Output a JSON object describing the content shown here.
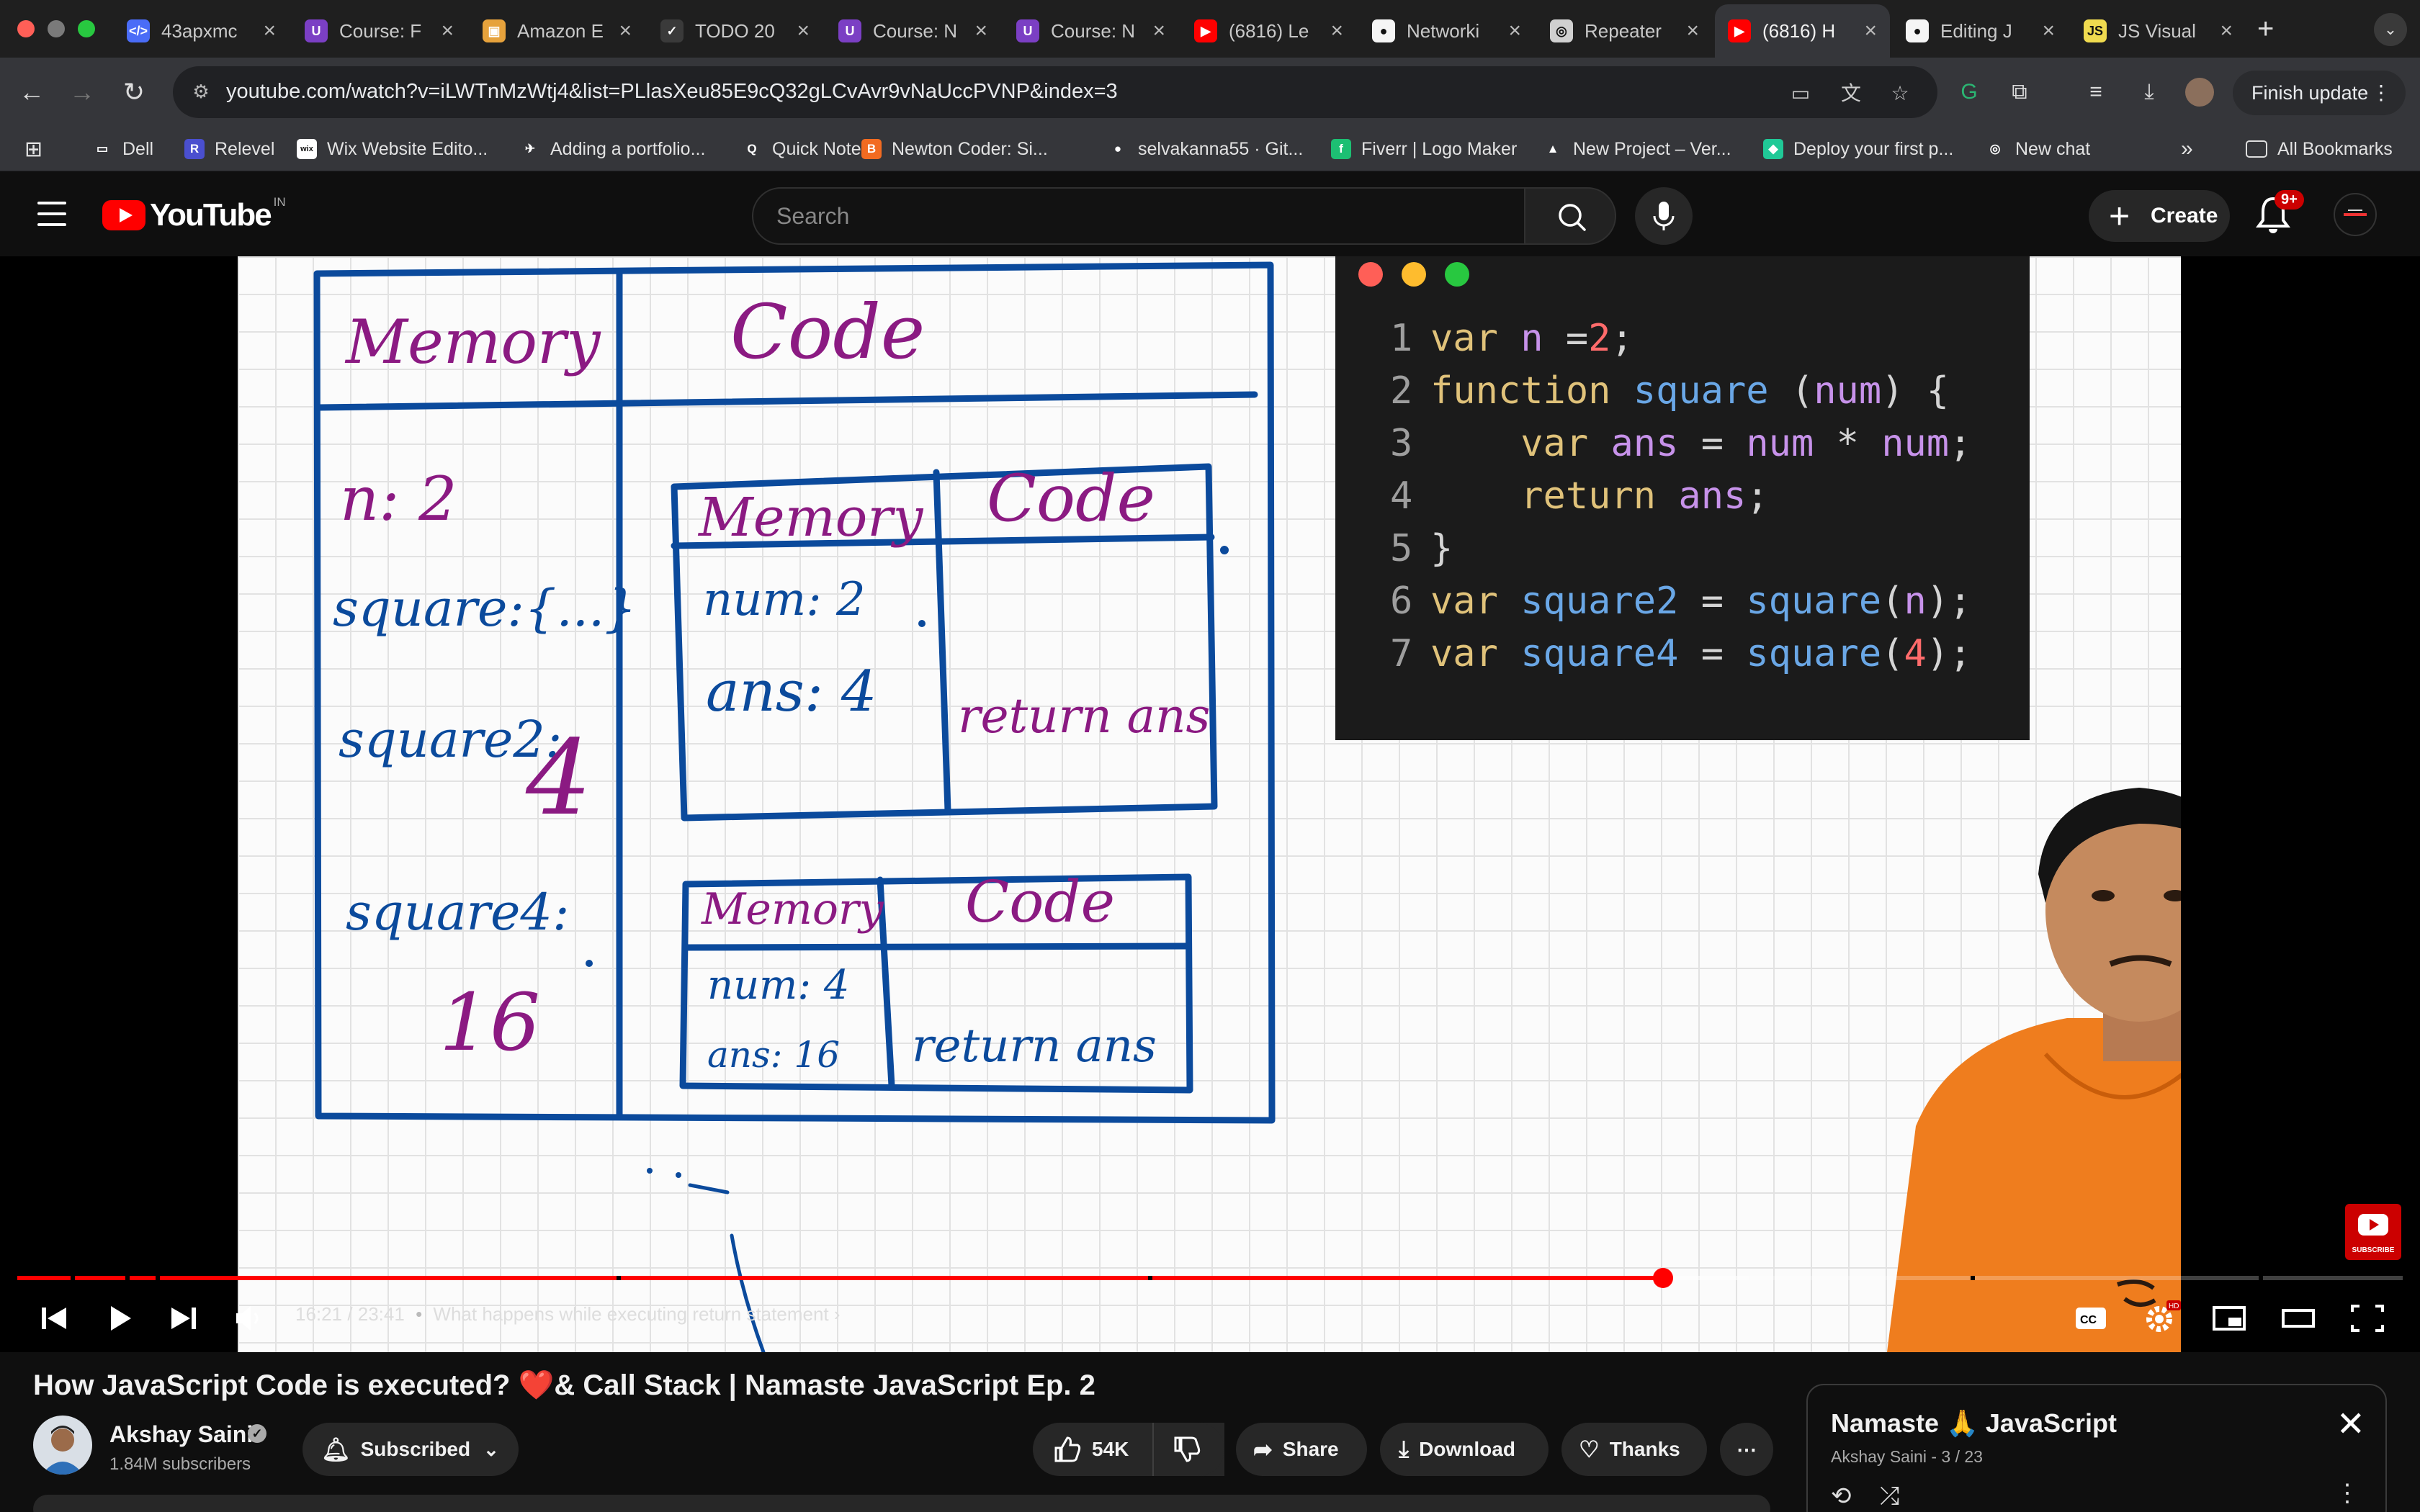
{
  "browser": {
    "tabs": [
      {
        "title": "43apxmc",
        "fav_color": "#4a6cf7",
        "fav_glyph": "</>"
      },
      {
        "title": "Course: F",
        "fav_color": "#7b3fc4",
        "fav_glyph": "U"
      },
      {
        "title": "Amazon E",
        "fav_color": "#e6a23c",
        "fav_glyph": "▣"
      },
      {
        "title": "TODO 20",
        "fav_color": "#3a3a3a",
        "fav_glyph": "✓"
      },
      {
        "title": "Course: N",
        "fav_color": "#7b3fc4",
        "fav_glyph": "U"
      },
      {
        "title": "Course: N",
        "fav_color": "#7b3fc4",
        "fav_glyph": "U"
      },
      {
        "title": "(6816) Le",
        "fav_color": "#ff0000",
        "fav_glyph": "▶"
      },
      {
        "title": "Networki",
        "fav_color": "#f5f5f5",
        "fav_glyph": "●"
      },
      {
        "title": "Repeater",
        "fav_color": "#d0d0d0",
        "fav_glyph": "◎"
      },
      {
        "title": "(6816) H",
        "fav_color": "#ff0000",
        "fav_glyph": "▶",
        "active": true
      },
      {
        "title": "Editing J",
        "fav_color": "#f5f5f5",
        "fav_glyph": "●"
      },
      {
        "title": "JS Visual",
        "fav_color": "#f0db4f",
        "fav_glyph": "JS"
      }
    ],
    "new_tab": "+",
    "url": "youtube.com/watch?v=iLWTnMzWtj4&list=PLlasXeu85E9cQ32gLCvAvr9vNaUccPVNP&index=3",
    "finish_update": "Finish update",
    "bookmarks": [
      {
        "label": "Dell",
        "color": "#35363a",
        "glyph": "▭"
      },
      {
        "label": "Relevel",
        "color": "#4a4fcf",
        "glyph": "R"
      },
      {
        "label": "Wix Website Edito...",
        "color": "#ffffff",
        "glyph": "wix"
      },
      {
        "label": "Adding a portfolio...",
        "color": "#35363a",
        "glyph": "✈"
      },
      {
        "label": "Quick Note",
        "color": "#35363a",
        "glyph": "Q"
      },
      {
        "label": "Newton Coder: Si...",
        "color": "#f26b21",
        "glyph": "B"
      },
      {
        "label": "selvakanna55 · Git...",
        "color": "#35363a",
        "glyph": "●"
      },
      {
        "label": "Fiverr | Logo Maker",
        "color": "#1dbf73",
        "glyph": "f"
      },
      {
        "label": "New Project – Ver...",
        "color": "#35363a",
        "glyph": "▲"
      },
      {
        "label": "Deploy your first p...",
        "color": "#20c997",
        "glyph": "◆"
      },
      {
        "label": "New chat",
        "color": "#35363a",
        "glyph": "◎"
      }
    ],
    "all_bookmarks": "All Bookmarks",
    "overflow": "»"
  },
  "youtube": {
    "logo_text": "YouTube",
    "country_code": "IN",
    "search_placeholder": "Search",
    "create_label": "Create",
    "notif_count": "9+"
  },
  "video": {
    "whiteboard": {
      "outer_memory": "Memory",
      "outer_code": "Code",
      "mem_n": "n: 2",
      "mem_square": "square:{...}",
      "mem_square2": "square2:",
      "mem_square2_val": "4",
      "mem_square4": "square4:",
      "mem_square4_val": "16",
      "ctx1_memory": "Memory",
      "ctx1_code": "Code",
      "ctx1_num": "num: 2",
      "ctx1_ans": "ans: 4",
      "ctx1_return": "return ans",
      "ctx2_memory": "Memory",
      "ctx2_code": "Code",
      "ctx2_num": "num: 4",
      "ctx2_ans": "ans: 16",
      "ctx2_return": "return ans"
    },
    "code_lines": [
      "1 var n =2;",
      "2 function square (num) {",
      "3     var ans = num * num;",
      "4     return ans;",
      "5 }",
      "6 var square2 = square(n);",
      "7 var square4 = square(4);"
    ],
    "watermark": "SUBSCRIBE",
    "current_time": "16:21",
    "duration": "23:41",
    "chapter": "What happens while executing return statement",
    "progress_fraction": 0.69,
    "buffer_fraction": 0.726
  },
  "meta": {
    "title": "How JavaScript Code is executed? ❤️& Call Stack | Namaste JavaScript Ep. 2",
    "channel": "Akshay Saini",
    "subscribers": "1.84M subscribers",
    "subscribed_label": "Subscribed",
    "likes": "54K",
    "share": "Share",
    "download": "Download",
    "thanks": "Thanks",
    "more": "⋯"
  },
  "playlist": {
    "title": "Namaste 🙏 JavaScript",
    "subtitle": "Akshay Saini - 3 / 23"
  }
}
